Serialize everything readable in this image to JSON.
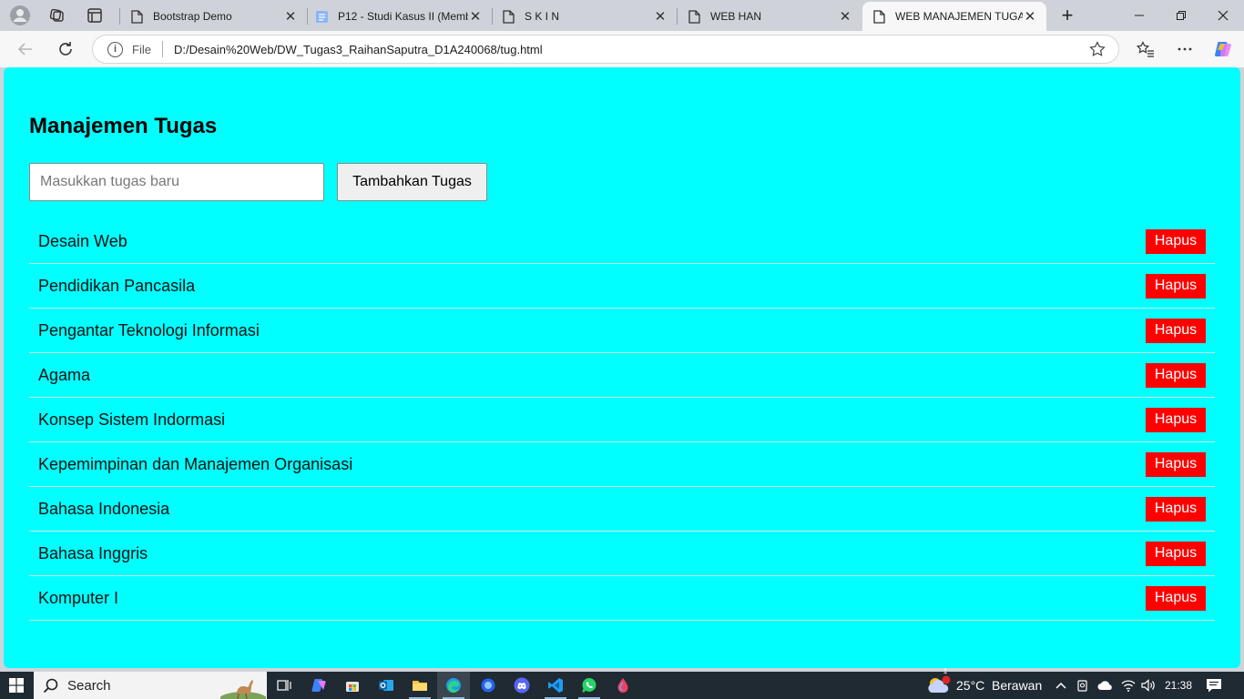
{
  "browser": {
    "tabs": [
      {
        "title": "Bootstrap Demo",
        "icon": "page-icon",
        "active": false
      },
      {
        "title": "P12 - Studi Kasus II (Memb",
        "icon": "doc-icon",
        "active": false
      },
      {
        "title": "S K I N",
        "icon": "page-icon",
        "active": false
      },
      {
        "title": "WEB HAN",
        "icon": "page-icon",
        "active": false
      },
      {
        "title": "WEB MANAJEMEN TUGAS",
        "icon": "page-icon",
        "active": true
      }
    ],
    "close_glyph": "✕",
    "new_tab_glyph": "+",
    "address": {
      "scheme_label": "File",
      "url": "D:/Desain%20Web/DW_Tugas3_RaihanSaputra_D1A240068/tug.html"
    }
  },
  "page": {
    "title": "Manajemen Tugas",
    "input_placeholder": "Masukkan tugas baru",
    "add_button_label": "Tambahkan Tugas",
    "delete_label": "Hapus",
    "tasks": [
      "Desain Web",
      "Pendidikan Pancasila",
      "Pengantar Teknologi Informasi",
      "Agama",
      "Konsep Sistem Indormasi",
      "Kepemimpinan dan Manajemen Organisasi",
      "Bahasa Indonesia",
      "Bahasa Inggris",
      "Komputer I"
    ],
    "colors": {
      "background": "#00ffff",
      "delete_button": "#ff0000"
    }
  },
  "taskbar": {
    "search_label": "Search",
    "weather": {
      "temperature": "25°C",
      "condition": "Berawan",
      "badge": "1"
    },
    "clock": "21:38"
  }
}
